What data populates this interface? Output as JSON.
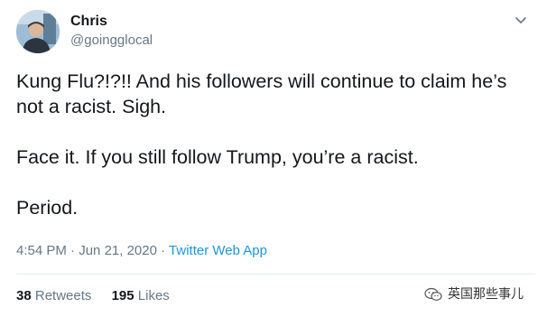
{
  "tweet": {
    "author": {
      "name": "Chris",
      "handle": "@goingglocal"
    },
    "text": {
      "line1": "Kung Flu?!?!! And his followers will continue to claim he’s not a racist. Sigh.",
      "line2": "Face it. If you still follow Trump, you’re a racist.",
      "line3": "Period."
    },
    "meta": {
      "time": "4:54 PM",
      "separator": "·",
      "date": "Jun 21, 2020",
      "app": "Twitter Web App"
    },
    "stats": {
      "retweets_count": "38",
      "retweets_label": "Retweets",
      "likes_count": "195",
      "likes_label": "Likes"
    }
  },
  "watermark": {
    "text": "英国那些事儿"
  },
  "icons": {
    "menu": "chevron-down-icon",
    "watermark": "wechat-icon"
  },
  "colors": {
    "text": "#14171a",
    "secondary": "#657786",
    "link": "#1b95e0",
    "divider": "#e6ecf0"
  }
}
